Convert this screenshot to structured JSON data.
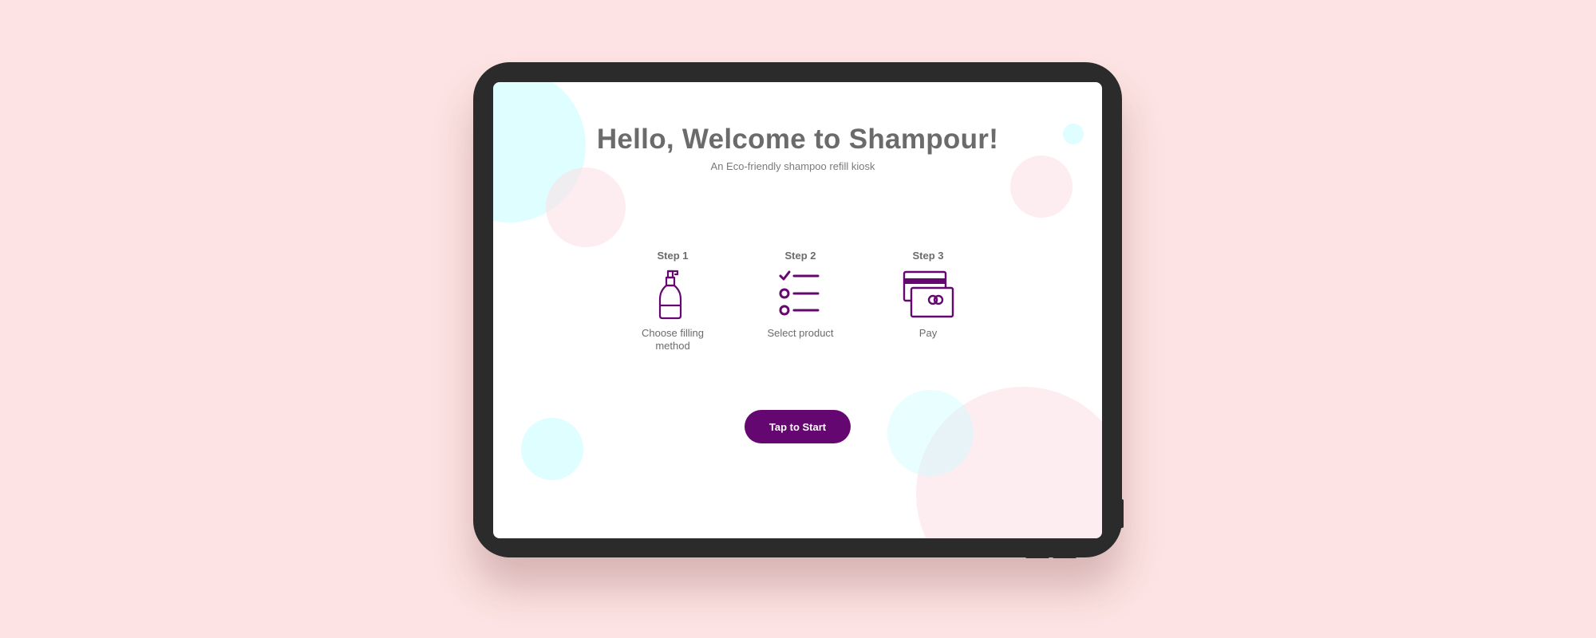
{
  "welcome": {
    "title": "Hello, Welcome to Shampour!",
    "subtitle": "An Eco-friendly shampoo refill kiosk"
  },
  "steps": [
    {
      "label": "Step 1",
      "text": "Choose filling method",
      "icon": "shampoo-bottle-icon"
    },
    {
      "label": "Step 2",
      "text": "Select product",
      "icon": "checklist-icon"
    },
    {
      "label": "Step 3",
      "text": "Pay",
      "icon": "credit-card-icon"
    }
  ],
  "start_button": {
    "label": "Tap to Start"
  },
  "colors": {
    "accent": "#650770",
    "background": "#fde3e3",
    "text": "#6b6b6b",
    "bubble_cyan": "#c8fdff",
    "bubble_pink": "#fddee4"
  }
}
